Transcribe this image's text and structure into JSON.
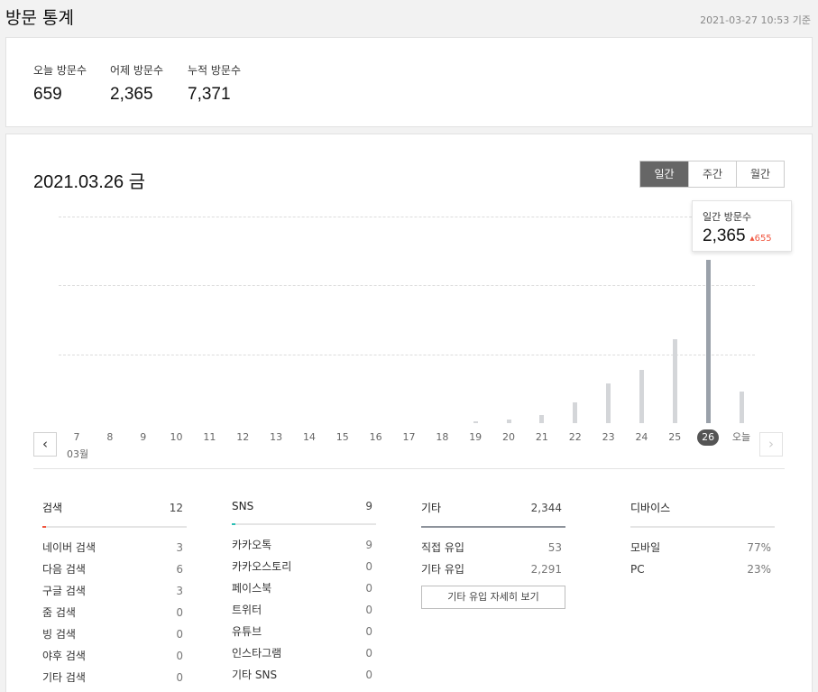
{
  "header": {
    "title": "방문 통계",
    "updated": "2021-03-27 10:53 기준"
  },
  "summary": [
    {
      "label": "오늘 방문수",
      "value": "659"
    },
    {
      "label": "어제 방문수",
      "value": "2,365"
    },
    {
      "label": "누적 방문수",
      "value": "7,371"
    }
  ],
  "chart": {
    "date_title": "2021.03.26 금",
    "tabs": [
      "일간",
      "주간",
      "월간"
    ],
    "active_tab": "일간",
    "month_label": "03월",
    "tooltip": {
      "label": "일간 방문수",
      "value": "2,365",
      "delta": "655"
    },
    "prev_icon": "chevron-left-icon",
    "next_icon": "chevron-right-icon"
  },
  "chart_data": {
    "type": "bar",
    "categories": [
      "7",
      "8",
      "9",
      "10",
      "11",
      "12",
      "13",
      "14",
      "15",
      "16",
      "17",
      "18",
      "19",
      "20",
      "21",
      "22",
      "23",
      "24",
      "25",
      "26",
      "오늘"
    ],
    "values": [
      0,
      0,
      0,
      0,
      0,
      0,
      0,
      0,
      0,
      0,
      0,
      0,
      5,
      50,
      120,
      300,
      570,
      770,
      1210,
      2365,
      460
    ],
    "selected": "26",
    "ylim": [
      0,
      3000
    ],
    "grid": true,
    "bar_color": "#d4d6d9",
    "selected_color": "#9aa1aa"
  },
  "referrers": {
    "search": {
      "title": "검색",
      "count": "12",
      "accent": "#f0553e",
      "rows": [
        {
          "name": "네이버 검색",
          "value": "3"
        },
        {
          "name": "다음 검색",
          "value": "6"
        },
        {
          "name": "구글 검색",
          "value": "3"
        },
        {
          "name": "줌 검색",
          "value": "0"
        },
        {
          "name": "빙 검색",
          "value": "0"
        },
        {
          "name": "야후 검색",
          "value": "0"
        },
        {
          "name": "기타 검색",
          "value": "0"
        }
      ]
    },
    "sns": {
      "title": "SNS",
      "count": "9",
      "accent": "#2bbfb5",
      "rows": [
        {
          "name": "카카오톡",
          "value": "9"
        },
        {
          "name": "카카오스토리",
          "value": "0"
        },
        {
          "name": "페이스북",
          "value": "0"
        },
        {
          "name": "트위터",
          "value": "0"
        },
        {
          "name": "유튜브",
          "value": "0"
        },
        {
          "name": "인스타그램",
          "value": "0"
        },
        {
          "name": "기타 SNS",
          "value": "0"
        }
      ]
    },
    "etc": {
      "title": "기타",
      "count": "2,344",
      "rows": [
        {
          "name": "직접 유입",
          "value": "53"
        },
        {
          "name": "기타 유입",
          "value": "2,291"
        }
      ],
      "detail_button": "기타 유입 자세히 보기"
    },
    "device": {
      "title": "디바이스",
      "rows": [
        {
          "name": "모바일",
          "value": "77%"
        },
        {
          "name": "PC",
          "value": "23%"
        }
      ]
    }
  }
}
